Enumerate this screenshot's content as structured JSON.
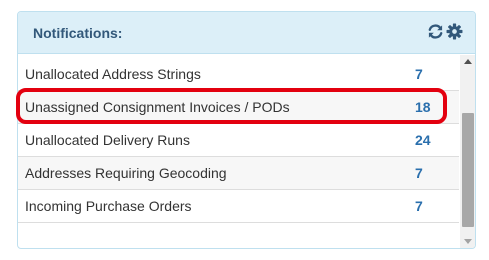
{
  "panel": {
    "title": "Notifications:",
    "icons": [
      "refresh-icon",
      "gear-icon"
    ]
  },
  "notifications": [
    {
      "label": "Unallocated Address Strings",
      "count": "7"
    },
    {
      "label": "Unassigned Consignment Invoices / PODs",
      "count": "18",
      "highlighted": true
    },
    {
      "label": "Unallocated Delivery Runs",
      "count": "24"
    },
    {
      "label": "Addresses Requiring Geocoding",
      "count": "7"
    },
    {
      "label": "Incoming Purchase Orders",
      "count": "7"
    }
  ],
  "colors": {
    "header_bg": "#dceff8",
    "title": "#32587a",
    "count": "#2a6fad",
    "highlight": "#e3000f"
  }
}
